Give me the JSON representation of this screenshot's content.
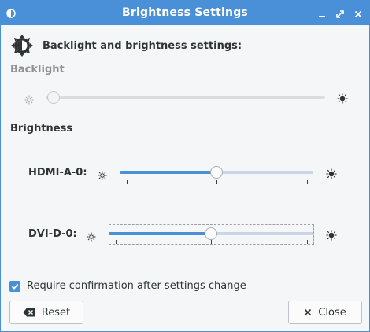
{
  "window": {
    "title": "Brightness Settings"
  },
  "header": {
    "text": "Backlight and brightness settings:"
  },
  "backlight": {
    "label": "Backlight",
    "enabled": false,
    "level": 0.0
  },
  "brightness": {
    "label": "Brightness",
    "outputs": [
      {
        "name": "HDMI-A-0:",
        "level": 0.5
      },
      {
        "name": "DVI-D-0:",
        "level": 0.5
      }
    ]
  },
  "confirm": {
    "label": "Require confirmation after settings change",
    "checked": true
  },
  "buttons": {
    "reset": "Reset",
    "close": "Close"
  },
  "colors": {
    "accent": "#4a90d9",
    "titlebar": "#4a90d9",
    "background": "#f5f6f7",
    "text": "#2e3436",
    "disabled_text": "#8f9193"
  },
  "icons": {
    "app": "brightness-icon",
    "header": "brightness-icon",
    "minimize": "minimize-icon",
    "maximize": "maximize-icon",
    "close": "close-icon",
    "dim": "sun-small-icon",
    "bright": "sun-large-icon",
    "reset": "backspace-icon",
    "close_button": "x-icon"
  }
}
